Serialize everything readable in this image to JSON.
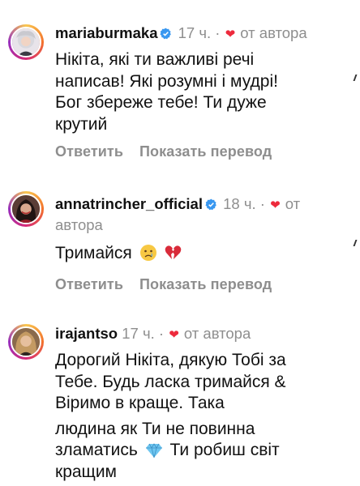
{
  "comments": [
    {
      "username": "mariaburmaka",
      "verified": true,
      "time": "17 ч.",
      "separator": "·",
      "from_author": "от автора",
      "text_lines": [
        "Нікіта, які ти важливі речі",
        "написав! Які розумні і мудрі!",
        "Бог збереже тебе! Ти дуже",
        "крутий"
      ],
      "reply_label": "Ответить",
      "translate_label": "Показать перевод"
    },
    {
      "username": "annatrincher_official",
      "verified": true,
      "time": "18 ч.",
      "separator": "·",
      "from_author_1": "от",
      "from_author_2": "автора",
      "text": "Тримайся",
      "emojis": [
        "crying-face",
        "broken-heart"
      ],
      "reply_label": "Ответить",
      "translate_label": "Показать перевод"
    },
    {
      "username": "irajantso",
      "verified": false,
      "time": "17 ч.",
      "separator": "·",
      "from_author": "от автора",
      "text_lines": [
        "Дорогий Нікіта, дякую Тобі за",
        "Тебе. Будь ласка тримайся &",
        "Віримо в краще. Така",
        "людина як Ти не повинна",
        "зламатись",
        "Ти робиш світ",
        "кращим"
      ],
      "emojis": [
        "gem"
      ]
    }
  ],
  "colors": {
    "heart": "#ed2a3c",
    "verified": "#3897f0",
    "meta": "#8e8e8e"
  }
}
